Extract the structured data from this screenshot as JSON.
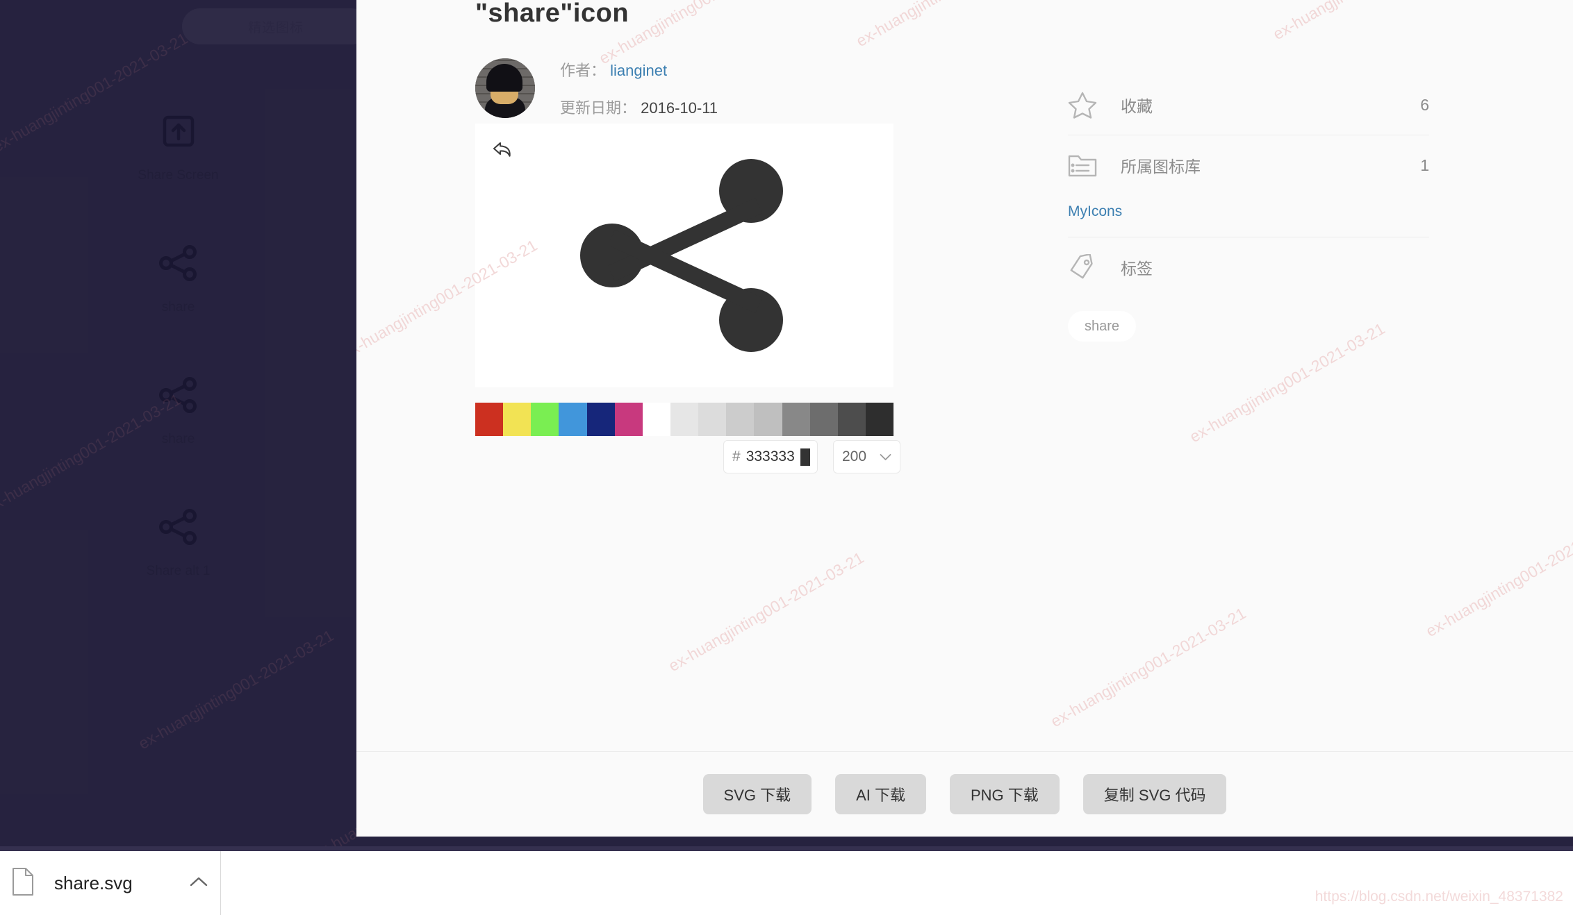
{
  "backdrop": {
    "featured_label": "精选图标",
    "gallery": [
      {
        "label": "Share Screen",
        "icon": "share-screen-icon"
      },
      {
        "label": "share",
        "icon": "share-icon"
      },
      {
        "label": "share",
        "icon": "share-icon"
      },
      {
        "label": "Share alt 1",
        "icon": "share-alt-icon"
      }
    ]
  },
  "modal": {
    "title": "\"share\"icon",
    "author_label": "作者：",
    "author_name": "lianginet",
    "updated_label": "更新日期：",
    "updated_date": "2016-10-11",
    "undo_icon": "undo-icon",
    "preview_icon": "share-icon",
    "palette": [
      "#cc3020",
      "#f2e354",
      "#7aee52",
      "#4196db",
      "#16267a",
      "#c8397e",
      "#ffffff",
      "#e6e6e6",
      "#dcdcdc",
      "#cccccc",
      "#bfbfbf",
      "#888888",
      "#6d6d6d",
      "#4d4d4d",
      "#2e2e2e"
    ],
    "hex": {
      "hash": "#",
      "value": "333333",
      "swatch_color": "#333333"
    },
    "size": {
      "value": "200",
      "chevron_icon": "chevron-down-icon"
    },
    "info": {
      "favorites": {
        "icon": "star-icon",
        "label": "收藏",
        "count": "6"
      },
      "library": {
        "icon": "folder-list-icon",
        "label": "所属图标库",
        "count": "1",
        "link": "MyIcons"
      },
      "tags": {
        "icon": "tag-icon",
        "label": "标签",
        "chips": [
          "share"
        ]
      }
    },
    "footer_buttons": [
      {
        "label": "SVG 下载",
        "name": "svg-download-button"
      },
      {
        "label": "AI 下载",
        "name": "ai-download-button"
      },
      {
        "label": "PNG 下载",
        "name": "png-download-button"
      },
      {
        "label": "复制 SVG 代码",
        "name": "copy-svg-code-button"
      }
    ]
  },
  "browser": {
    "download": {
      "file_icon": "file-icon",
      "file_name": "share.svg",
      "chevron_icon": "chevron-up-icon"
    }
  },
  "watermark": {
    "text": "ex-huangjinting001-2021-03-21",
    "url": "https://blog.csdn.net/weixin_48371382"
  }
}
